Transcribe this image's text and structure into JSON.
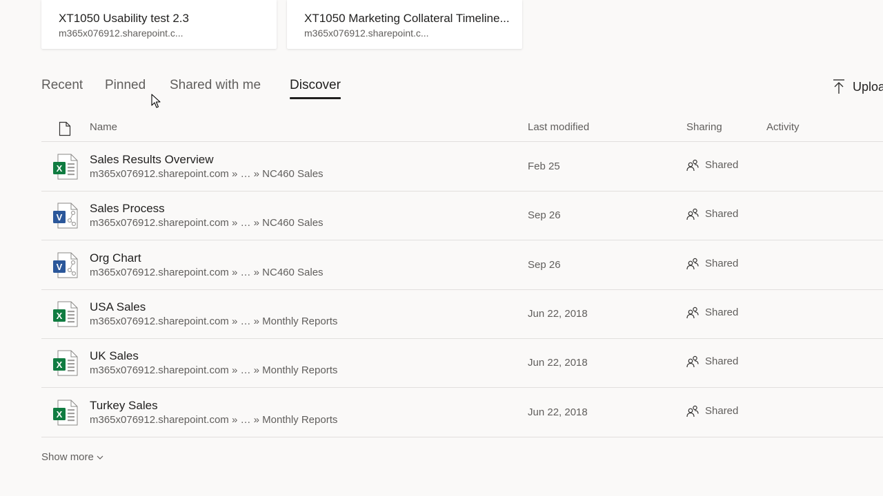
{
  "cards": [
    {
      "title": "XT1050 Usability test 2.3",
      "subtitle": "m365x076912.sharepoint.c..."
    },
    {
      "title": "XT1050 Marketing Collateral Timeline...",
      "subtitle": "m365x076912.sharepoint.c..."
    }
  ],
  "tabs": {
    "recent": "Recent",
    "pinned": "Pinned",
    "shared": "Shared with me",
    "discover": "Discover",
    "active": "discover"
  },
  "upload_label": "Uploa",
  "table": {
    "headers": {
      "name": "Name",
      "last_modified": "Last modified",
      "sharing": "Sharing",
      "activity": "Activity"
    },
    "rows": [
      {
        "app": "excel",
        "name": "Sales Results Overview",
        "path": "m365x076912.sharepoint.com » … » NC460 Sales",
        "modified": "Feb 25",
        "sharing": "Shared"
      },
      {
        "app": "visio",
        "name": "Sales Process",
        "path": "m365x076912.sharepoint.com » … » NC460 Sales",
        "modified": "Sep 26",
        "sharing": "Shared"
      },
      {
        "app": "visio",
        "name": "Org Chart",
        "path": "m365x076912.sharepoint.com » … » NC460 Sales",
        "modified": "Sep 26",
        "sharing": "Shared"
      },
      {
        "app": "excel",
        "name": "USA Sales",
        "path": "m365x076912.sharepoint.com » … » Monthly Reports",
        "modified": "Jun 22, 2018",
        "sharing": "Shared"
      },
      {
        "app": "excel",
        "name": "UK Sales",
        "path": "m365x076912.sharepoint.com » … » Monthly Reports",
        "modified": "Jun 22, 2018",
        "sharing": "Shared"
      },
      {
        "app": "excel",
        "name": "Turkey Sales",
        "path": "m365x076912.sharepoint.com » … » Monthly Reports",
        "modified": "Jun 22, 2018",
        "sharing": "Shared"
      }
    ]
  },
  "show_more": "Show more",
  "icons": {
    "file_header": "file-icon",
    "excel": "excel-file-icon",
    "visio": "visio-file-icon",
    "sharing": "people-icon",
    "upload": "upload-icon",
    "show_more": "chevron-down-icon"
  },
  "colors": {
    "excel": "#107c41",
    "visio": "#2b579a",
    "active_tab": "#201f1e",
    "background": "#faf9f8"
  }
}
